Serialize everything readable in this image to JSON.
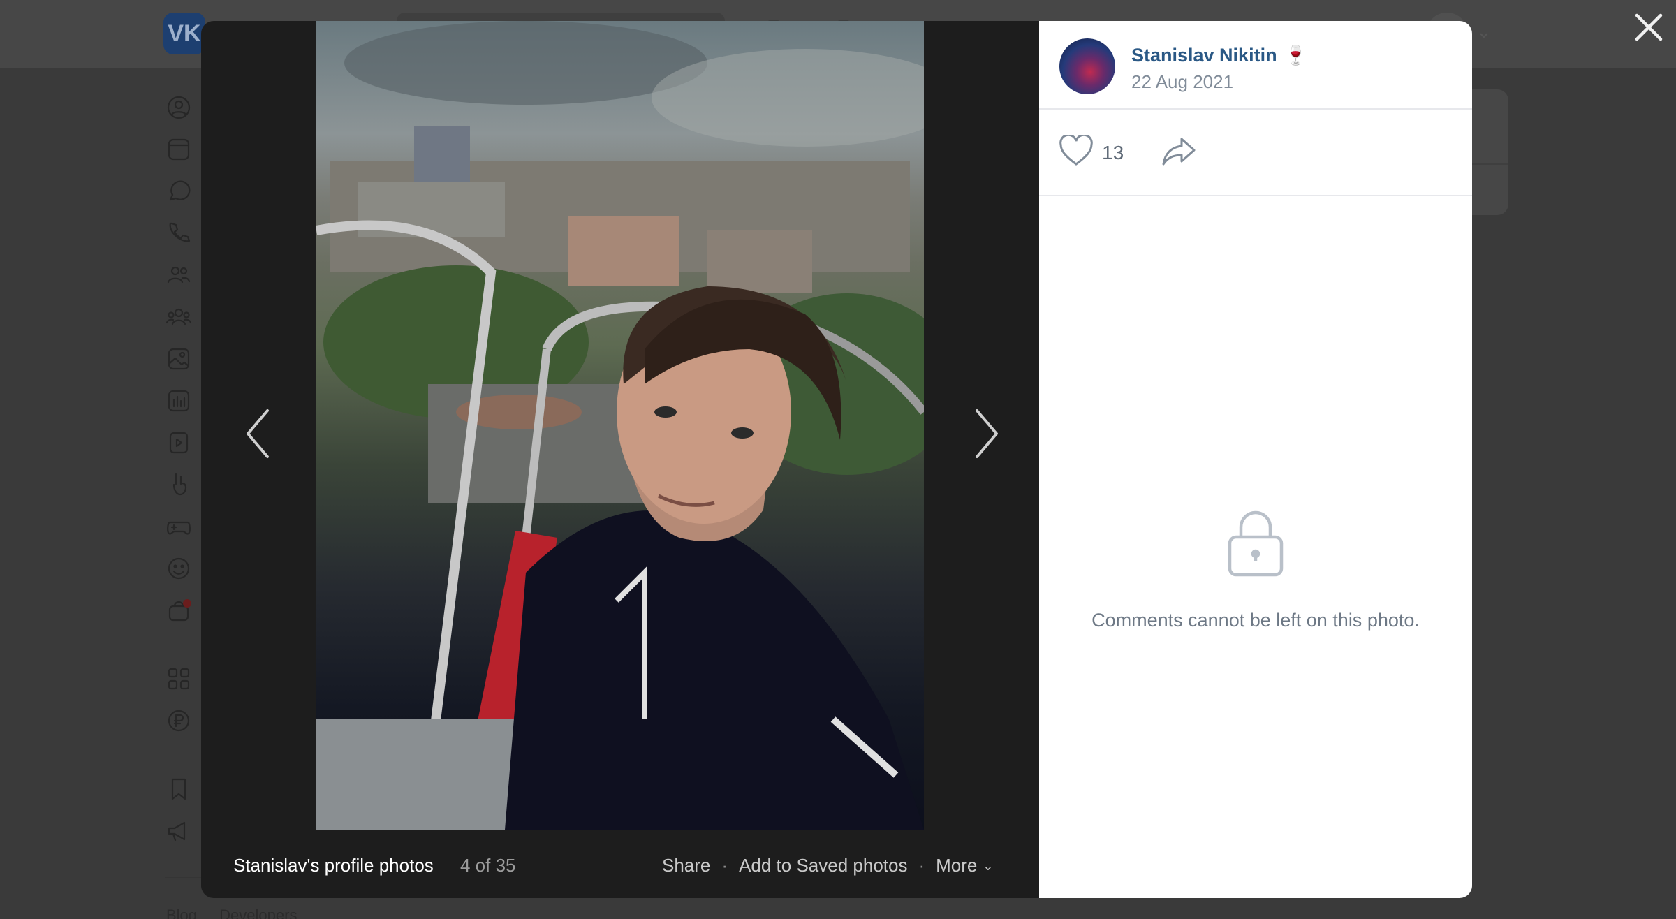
{
  "background": {
    "logo_text": "VK",
    "footer_links": [
      "Blog",
      "Developers"
    ]
  },
  "viewer": {
    "close_icon": "close-icon",
    "prev_icon": "chevron-left-icon",
    "next_icon": "chevron-right-icon",
    "album_title": "Stanislav's profile photos",
    "position": "4 of 35",
    "actions": {
      "share": "Share",
      "save": "Add to Saved photos",
      "more": "More",
      "separator": "·"
    }
  },
  "info": {
    "author_name": "Stanislav Nikitin",
    "author_emoji": "🍷",
    "date": "22 Aug 2021",
    "likes": "13",
    "comments_disabled": "Comments cannot be left on this photo."
  },
  "colors": {
    "link": "#2a5885",
    "muted": "#818c99",
    "overlay": "#3a3a3a"
  }
}
